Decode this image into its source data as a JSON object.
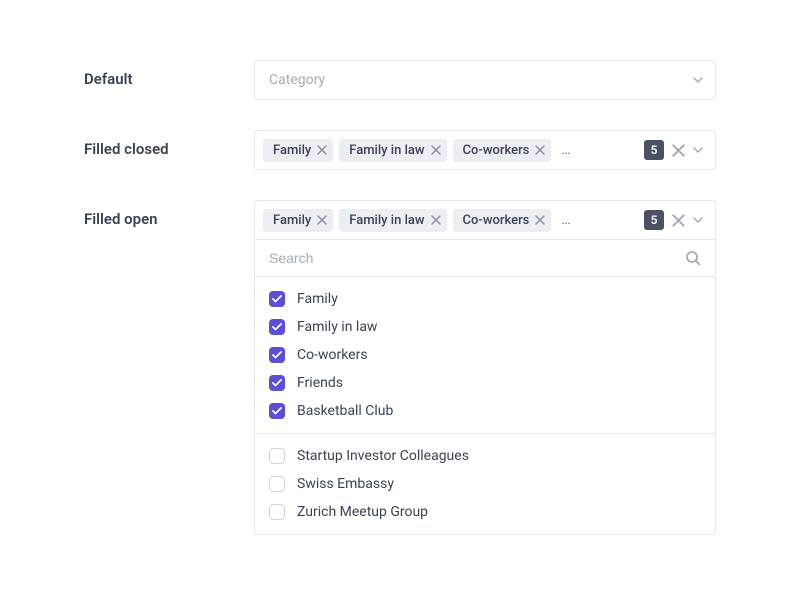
{
  "labels": {
    "default": "Default",
    "filled_closed": "Filled closed",
    "filled_open": "Filled open"
  },
  "default_select": {
    "placeholder": "Category"
  },
  "filled": {
    "chips": [
      "Family",
      "Family in law",
      "Co-workers"
    ],
    "overflow": "…",
    "count": "5"
  },
  "search": {
    "placeholder": "Search"
  },
  "options_checked": [
    "Family",
    "Family in law",
    "Co-workers",
    "Friends",
    "Basketball Club"
  ],
  "options_unchecked": [
    "Startup Investor Colleagues",
    "Swiss Embassy",
    "Zurich Meetup Group"
  ]
}
